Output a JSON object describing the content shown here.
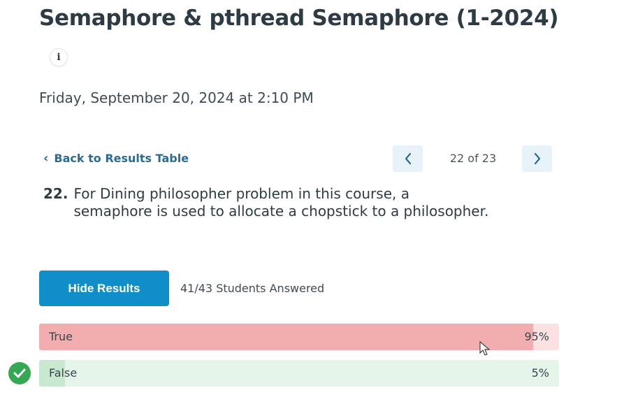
{
  "header": {
    "title": "Semaphore & pthread Semaphore (1-2024)",
    "info_icon": "i",
    "date": "Friday, September 20, 2024 at 2:10 PM"
  },
  "navigation": {
    "back_label": "Back to Results Table",
    "prev_icon": "chevron-left-icon",
    "next_icon": "chevron-right-icon",
    "counter": "22 of 23"
  },
  "question": {
    "number": "22.",
    "text": "For Dining philosopher problem in this course, a semaphore is used to allocate a chopstick to a philosopher."
  },
  "results": {
    "hide_button": "Hide Results",
    "answered": "41/43 Students Answered",
    "answers": [
      {
        "label": "True",
        "percent_text": "95%",
        "percent": 95,
        "correct": false,
        "fill_color": "#f2aeae",
        "track_color": "#fbe1e1"
      },
      {
        "label": "False",
        "percent_text": "5%",
        "percent": 5,
        "correct": true,
        "fill_color": "#c8e8cf",
        "track_color": "#e6f5e9"
      }
    ]
  },
  "colors": {
    "accent": "#0f8ec9",
    "link": "#2b6c92",
    "correct": "#34a853"
  }
}
